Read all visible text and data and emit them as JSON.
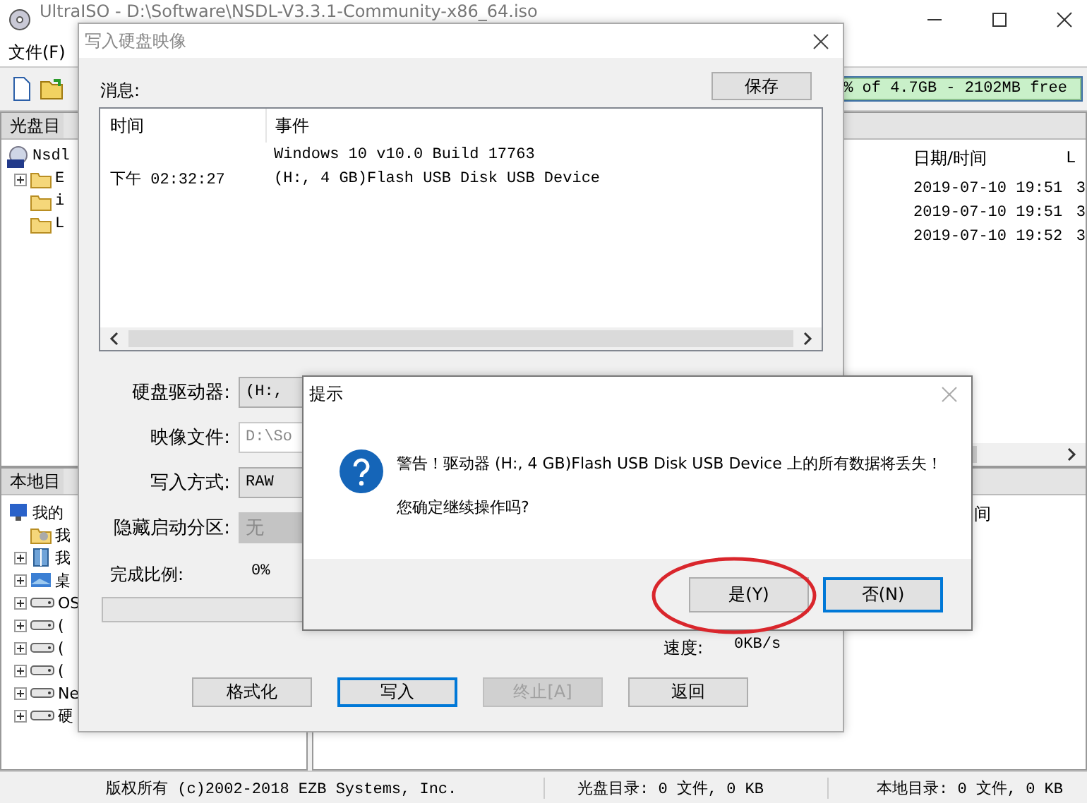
{
  "window": {
    "title": "UltraISO - D:\\Software\\NSDL-V3.3.1-Community-x86_64.iso"
  },
  "menu": [
    "文件(F)"
  ],
  "capacity": {
    "text": "% of 4.7GB - 2102MB free"
  },
  "iso_pane": {
    "header": "光盘目",
    "tree": [
      {
        "label": "Nsdl",
        "kind": "disc",
        "collapsed": false,
        "children": [
          {
            "label": "E",
            "kind": "folder",
            "collapsed": true
          },
          {
            "label": "i",
            "kind": "folder",
            "collapsed": false
          },
          {
            "label": "L",
            "kind": "folder",
            "collapsed": false
          }
        ]
      }
    ]
  },
  "iso_files": {
    "columns": [
      "日期/时间",
      "L"
    ],
    "rows": [
      [
        "2019-07-10 19:51",
        "3"
      ],
      [
        "2019-07-10 19:51",
        "3"
      ],
      [
        "2019-07-10 19:52",
        "3"
      ]
    ]
  },
  "local_pane": {
    "header": "本地目",
    "tree": [
      {
        "label": "我的",
        "kind": "computer",
        "collapsed": false,
        "children": [
          {
            "label": "我",
            "kind": "docs",
            "collapsed": false
          },
          {
            "label": "我",
            "kind": "book",
            "collapsed": true
          },
          {
            "label": "桌",
            "kind": "desktop",
            "collapsed": true
          },
          {
            "label": "OS",
            "kind": "drive",
            "collapsed": true
          },
          {
            "label": "(",
            "kind": "drive",
            "collapsed": true
          },
          {
            "label": "(",
            "kind": "drive",
            "collapsed": true
          },
          {
            "label": "(",
            "kind": "drive",
            "collapsed": true
          },
          {
            "label": "Ne",
            "kind": "drive",
            "collapsed": true
          },
          {
            "label": "硬",
            "kind": "drive",
            "collapsed": true
          }
        ]
      }
    ]
  },
  "local_files": {
    "columns": [
      "间"
    ]
  },
  "status_bar": [
    "版权所有 (c)2002-2018 EZB Systems, Inc.",
    "光盘目录: 0 文件, 0 KB",
    "本地目录: 0 文件, 0 KB"
  ],
  "write_dialog": {
    "title": "写入硬盘映像",
    "messages_label": "消息:",
    "save_button": "保存",
    "log": {
      "columns": [
        "时间",
        "事件"
      ],
      "rows": [
        [
          "",
          "Windows 10 v10.0 Build 17763"
        ],
        [
          "下午 02:32:27",
          "(H:, 4 GB)Flash USB Disk USB Device"
        ]
      ]
    },
    "fields": [
      {
        "label": "硬盘驱动器:",
        "value": "(H:,",
        "kind": "combo",
        "disabled": false
      },
      {
        "label": "映像文件:",
        "value": "D:\\So",
        "kind": "text",
        "disabled": true
      },
      {
        "label": "写入方式:",
        "value": "RAW",
        "kind": "combo",
        "disabled": false
      },
      {
        "label": "隐藏启动分区:",
        "value": "无",
        "kind": "combo",
        "disabled": true
      }
    ],
    "progress": {
      "label": "完成比例:",
      "value": "0%",
      "level": 0
    },
    "speed": {
      "label": "速度:",
      "value": "0KB/s"
    },
    "buttons": [
      {
        "label": "格式化",
        "focused": false,
        "disabled": false
      },
      {
        "label": "写入",
        "focused": true,
        "disabled": false
      },
      {
        "label": "终止[A]",
        "focused": false,
        "disabled": true
      },
      {
        "label": "返回",
        "focused": false,
        "disabled": false
      }
    ]
  },
  "confirm_dialog": {
    "title": "提示",
    "message": "警告！驱动器 (H:, 4 GB)Flash USB Disk USB Device 上的所有数据将丢失！",
    "question": "您确定继续操作吗?",
    "buttons": [
      {
        "label": "是(Y)",
        "default": false,
        "circled": true
      },
      {
        "label": "否(N)",
        "default": true,
        "circled": false
      }
    ]
  }
}
